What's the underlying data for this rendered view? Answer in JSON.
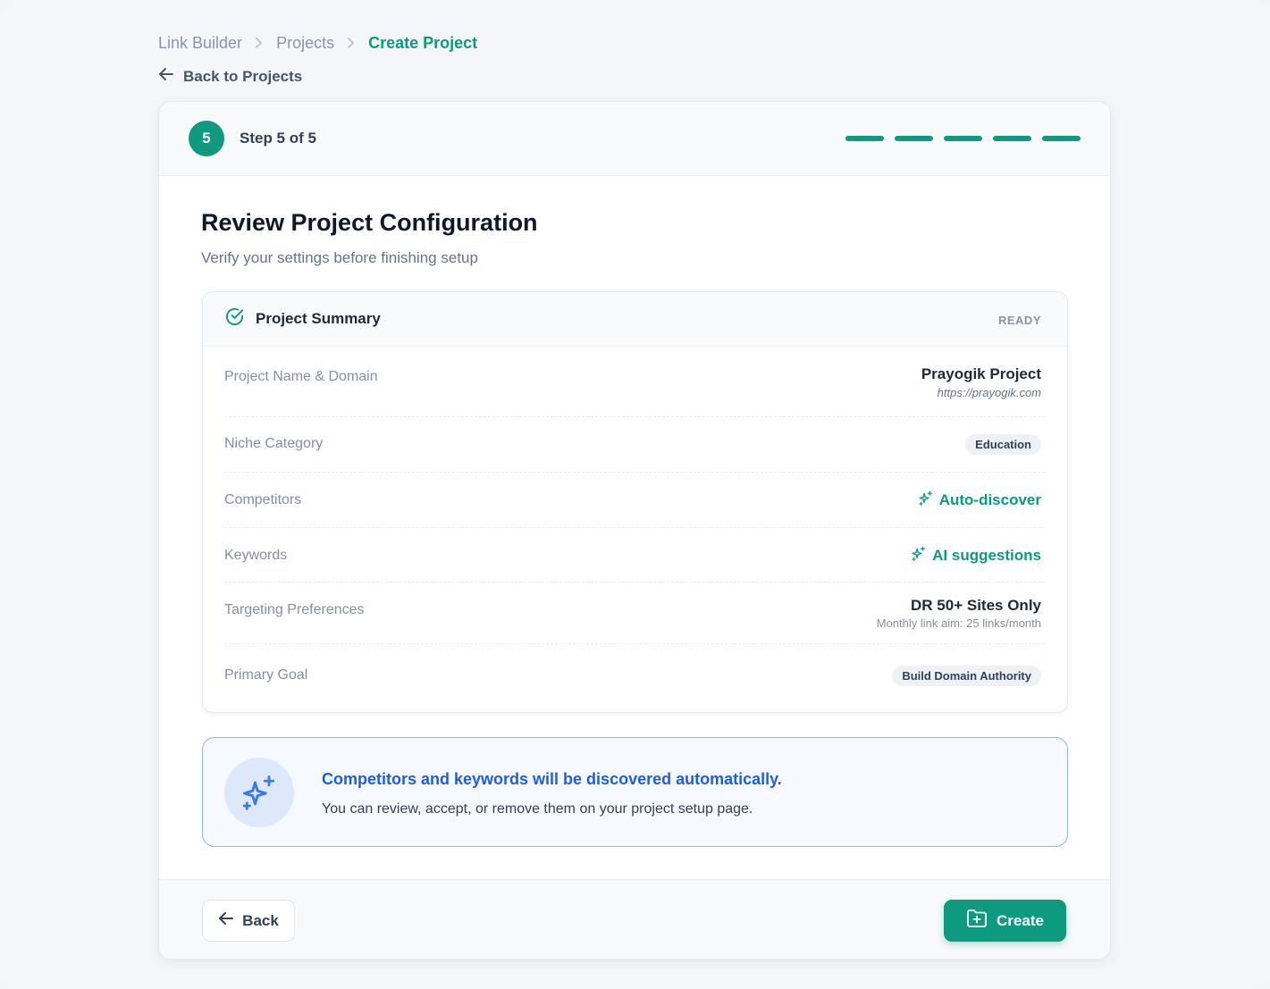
{
  "breadcrumb": {
    "items": [
      "Link Builder",
      "Projects",
      "Create Project"
    ]
  },
  "back_link": "Back to Projects",
  "stepper": {
    "number": "5",
    "label": "Step 5 of 5",
    "total_steps": 5,
    "completed_steps": 5
  },
  "page": {
    "title": "Review Project Configuration",
    "subtitle": "Verify your settings before finishing setup"
  },
  "summary": {
    "title": "Project Summary",
    "status": "READY",
    "rows": {
      "project": {
        "label": "Project Name & Domain",
        "name": "Prayogik Project",
        "url": "https://prayogik.com"
      },
      "niche": {
        "label": "Niche Category",
        "value": "Education"
      },
      "competitors": {
        "label": "Competitors",
        "value": "Auto-discover"
      },
      "keywords": {
        "label": "Keywords",
        "value": "AI suggestions"
      },
      "targeting": {
        "label": "Targeting Preferences",
        "value": "DR 50+ Sites Only",
        "detail": "Monthly link aim: 25 links/month"
      },
      "goal": {
        "label": "Primary Goal",
        "value": "Build Domain Authority"
      }
    }
  },
  "info": {
    "title": "Competitors and keywords will be discovered automatically.",
    "text": "You can review, accept, or remove them on your project setup page."
  },
  "footer": {
    "back_label": "Back",
    "create_label": "Create"
  },
  "colors": {
    "accent": "#0e9a7e",
    "info_blue": "#1d5ee0",
    "background": "#f4f6fa"
  }
}
